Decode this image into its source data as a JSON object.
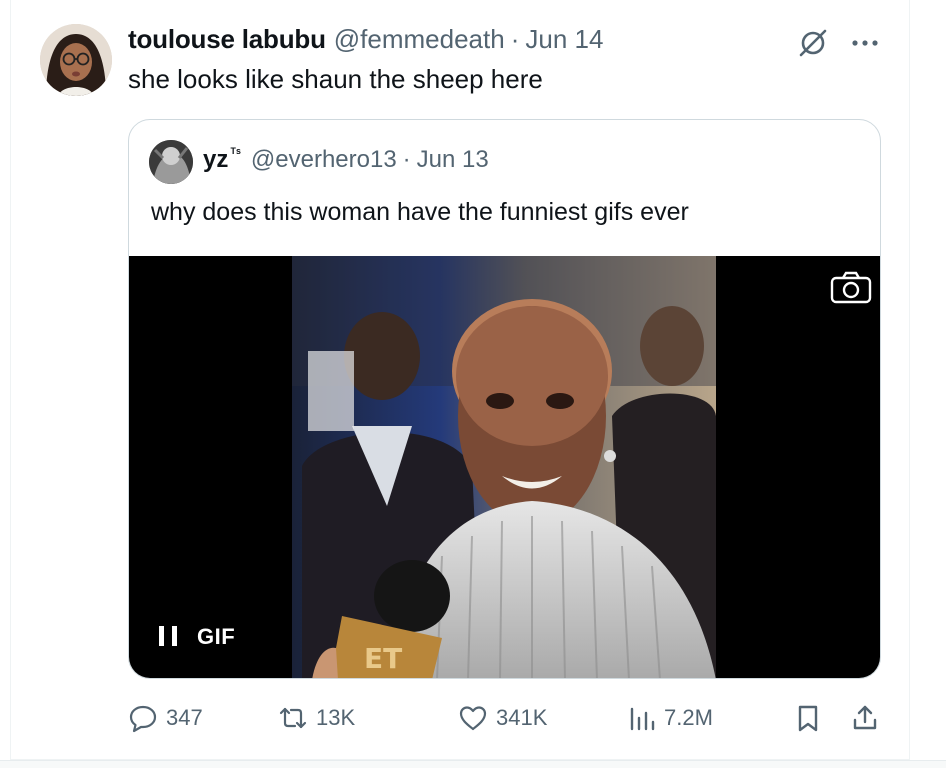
{
  "tweet": {
    "author_name": "toulouse labubu",
    "author_handle": "@femmedeath",
    "separator": "·",
    "date": "Jun 14",
    "text": "she looks like shaun the sheep here"
  },
  "quote": {
    "author_name": "yz",
    "author_badge": "ᵀˢ",
    "author_handle": "@everhero13",
    "separator": "·",
    "date": "Jun 13",
    "text": "why does this woman have the funniest gifs ever",
    "media": {
      "type": "gif",
      "label": "GIF",
      "state": "playing",
      "mic_flag_text": "ET"
    }
  },
  "actions": {
    "replies": "347",
    "reposts": "13K",
    "likes": "341K",
    "views": "7.2M"
  },
  "icons": {
    "grok": "grok-icon",
    "more": "more-icon",
    "reply": "reply-icon",
    "repost": "repost-icon",
    "like": "heart-icon",
    "views": "views-icon",
    "bookmark": "bookmark-icon",
    "share": "share-icon",
    "camera": "camera-icon",
    "pause": "pause-icon"
  },
  "colors": {
    "text_primary": "#0f1419",
    "text_secondary": "#536471",
    "border": "#cfd9de"
  }
}
